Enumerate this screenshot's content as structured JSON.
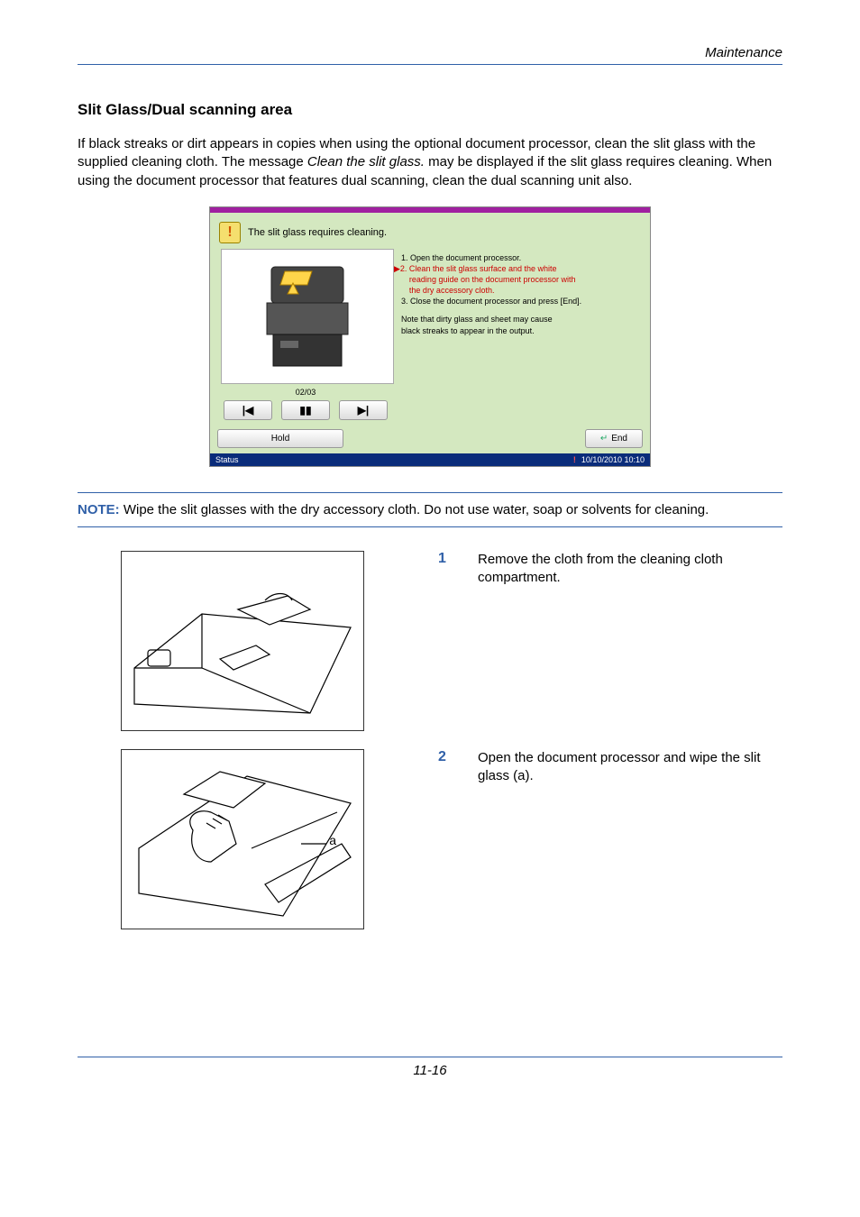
{
  "header": {
    "section": "Maintenance"
  },
  "title": "Slit Glass/Dual scanning area",
  "intro": {
    "part1": "If black streaks or dirt appears in copies when using the optional document processor, clean the slit glass with the supplied cleaning cloth. The message ",
    "italic": "Clean the slit glass.",
    "part2": " may be displayed if the slit glass requires cleaning. When using the document processor that features dual scanning, clean the dual scanning unit also."
  },
  "screen": {
    "title": "The slit glass requires cleaning.",
    "alert_glyph": "!",
    "steps": {
      "s1": "1. Open the document processor.",
      "s2": "2. Clean the slit glass surface and the white",
      "s2b": "reading guide on the document processor with",
      "s2c": "the dry accessory cloth.",
      "s3": "3. Close the document processor and press [End].",
      "note1": "Note that dirty glass and sheet may cause",
      "note2": "black streaks to appear in the output."
    },
    "counter": "02/03",
    "nav": {
      "prev": "|◀",
      "pause": "▮▮",
      "next": "▶|"
    },
    "hold": "Hold",
    "end": "End",
    "enter_glyph": "↵",
    "status": "Status",
    "datetime": "10/10/2010  10:10"
  },
  "note": {
    "label": "NOTE:",
    "text": " Wipe the slit glasses with the dry accessory cloth. Do not use water, soap or solvents for cleaning."
  },
  "steps": [
    {
      "num": "1",
      "text": "Remove the cloth from the cleaning cloth compartment."
    },
    {
      "num": "2",
      "text": "Open the document processor and wipe the slit glass (a)."
    }
  ],
  "figure2_label": "a",
  "footer": {
    "page": "11-16"
  }
}
